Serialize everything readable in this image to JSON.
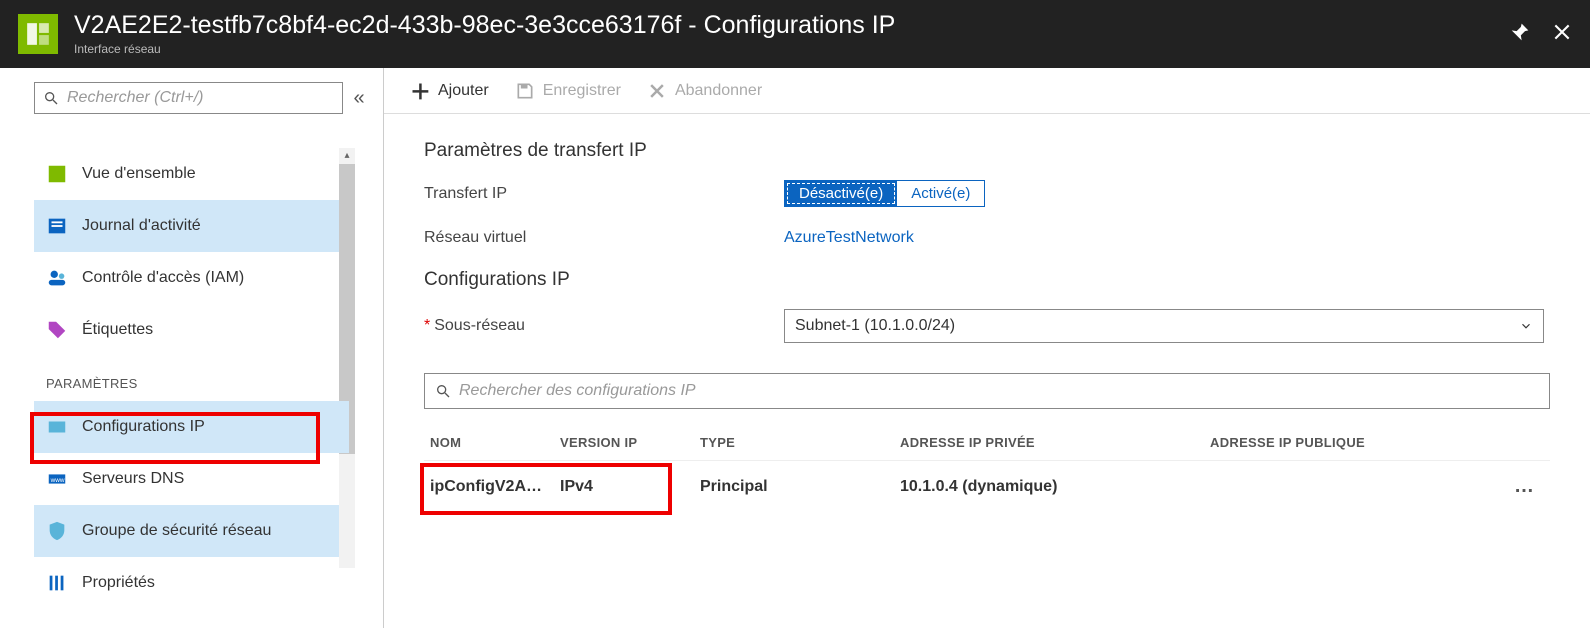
{
  "header": {
    "title": "V2AE2E2-testfb7c8bf4-ec2d-433b-98ec-3e3cce63176f - Configurations IP",
    "subtitle": "Interface réseau"
  },
  "sidebar": {
    "search_placeholder": "Rechercher (Ctrl+/)",
    "collapse_glyph": "«",
    "items": {
      "overview": "Vue d'ensemble",
      "activity_log": "Journal d'activité",
      "iam": "Contrôle d'accès (IAM)",
      "tags": "Étiquettes"
    },
    "group_settings": "Paramètres",
    "settings": {
      "ip_config": "Configurations IP",
      "dns": "Serveurs DNS",
      "nsg": "Groupe de sécurité réseau",
      "props": "Propriétés"
    }
  },
  "toolbar": {
    "add": "Ajouter",
    "save": "Enregistrer",
    "discard": "Abandonner"
  },
  "sections": {
    "ip_forward_title": "Paramètres de transfert IP",
    "ip_forward_label": "Transfert IP",
    "toggle_disabled": "Désactivé(e)",
    "toggle_enabled": "Activé(e)",
    "vnet_label": "Réseau virtuel",
    "vnet_value": "AzureTestNetwork",
    "ip_config_title": "Configurations IP",
    "subnet_label": "Sous-réseau",
    "subnet_value": "Subnet-1 (10.1.0.0/24)",
    "search_ip_placeholder": "Rechercher des configurations IP"
  },
  "table": {
    "headers": {
      "name": "NOM",
      "ipver": "VERSION IP",
      "type": "TYPE",
      "priv": "ADRESSE IP PRIVÉE",
      "pub": "ADRESSE IP PUBLIQUE"
    },
    "rows": [
      {
        "name": "ipConfigV2A…",
        "ipver": "IPv4",
        "type": "Principal",
        "priv": "10.1.0.4 (dynamique)",
        "pub": ""
      }
    ]
  }
}
